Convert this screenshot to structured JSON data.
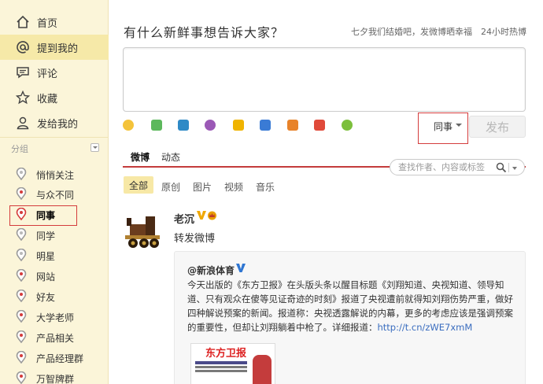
{
  "sidebar": {
    "nav": [
      {
        "label": "首页",
        "icon": "home-icon"
      },
      {
        "label": "提到我的",
        "icon": "at-icon"
      },
      {
        "label": "评论",
        "icon": "comment-icon"
      },
      {
        "label": "收藏",
        "icon": "star-icon"
      },
      {
        "label": "发给我的",
        "icon": "person-icon"
      }
    ],
    "group_header": "分组",
    "groups": [
      {
        "label": "悄悄关注"
      },
      {
        "label": "与众不同"
      },
      {
        "label": "同事"
      },
      {
        "label": "同学"
      },
      {
        "label": "明星"
      },
      {
        "label": "网站"
      },
      {
        "label": "好友"
      },
      {
        "label": "大学老师"
      },
      {
        "label": "产品相关"
      },
      {
        "label": "产品经理群"
      },
      {
        "label": "万智牌群"
      }
    ]
  },
  "composer": {
    "prompt": "有什么新鲜事想告诉大家？",
    "hot_topic": "七夕我们结婚吧，发微博晒幸福",
    "hot_link": "24小时热博",
    "visibility": "同事",
    "publish_label": "发布",
    "tools": [
      "emoji-icon",
      "image-icon",
      "video-icon",
      "music-icon",
      "topic-icon",
      "vote-icon",
      "chart-icon",
      "gift-icon",
      "weather-icon"
    ]
  },
  "feed_tabs": {
    "tabs": [
      "微博",
      "动态"
    ],
    "search_placeholder": "查找作者、内容或标签",
    "filters": [
      "全部",
      "原创",
      "图片",
      "视频",
      "音乐"
    ]
  },
  "post": {
    "author": "老沉",
    "text": "转发微博",
    "repost": {
      "author": "@新浪体育",
      "text": "今天出版的《东方卫报》在头版头条以醒目标题《刘翔知道、央视知道、领导知道、只有观众在傻等见证奇迹的时刻》报道了央视遭前就得知刘翔伤势严重，做好四种解说预案的新闻。报道称：央视透露解说的内幕，更多的考虑应该是强调预案的重要性，但却让刘翔躺着中枪了。详细报道：",
      "link": "http://t.cn/zWE7xmM",
      "image_title": "东方卫报"
    }
  },
  "colors": {
    "sidebar_bg": "#fbf5d9",
    "sidebar_active": "#f6e9a8",
    "accent_red": "#c43c3c",
    "link_blue": "#3a6dbf"
  }
}
